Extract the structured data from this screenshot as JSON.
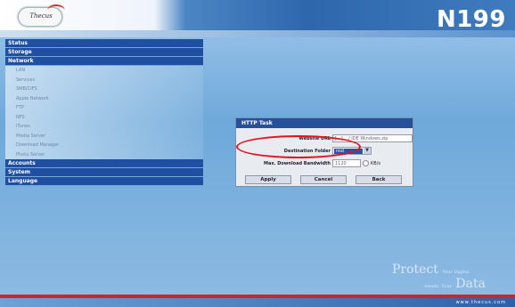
{
  "header": {
    "logo_text": "Thecus",
    "model": "N199"
  },
  "sidebar": {
    "sections": [
      {
        "label": "Status"
      },
      {
        "label": "Storage"
      },
      {
        "label": "Network",
        "items": [
          "LAN",
          "Services",
          "SMB/CIFS",
          "Apple Network",
          "FTP",
          "NFS",
          "iTunes",
          "Media Server",
          "Download Manager",
          "Photo Server"
        ]
      },
      {
        "label": "Accounts"
      },
      {
        "label": "System"
      },
      {
        "label": "Language"
      }
    ]
  },
  "dialog": {
    "title": "HTTP Task",
    "website_url_label": "Website URL",
    "website_url_value": "[...] .../ IDE Windows.zip",
    "destination_label": "Destination Folder",
    "destination_value": "nsd",
    "bandwidth_label": "Max. Download Bandwidth",
    "bandwidth_value": "1120",
    "bandwidth_unit": "KB/s",
    "apply_label": "Apply",
    "cancel_label": "Cancel",
    "back_label": "Back"
  },
  "footer": {
    "tagline_word1": "Protect",
    "tagline_small1": "Your Digital",
    "tagline_small2": "Assets. Your",
    "tagline_word2": "Data",
    "url": "www.thecus.com"
  },
  "colors": {
    "accent": "#26509c",
    "highlight_circle": "#e0141e"
  }
}
